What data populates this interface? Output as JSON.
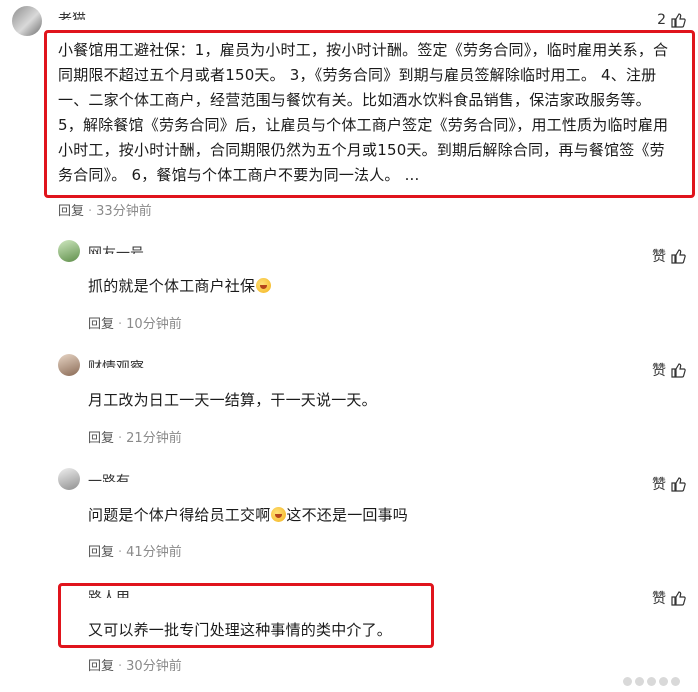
{
  "comments": [
    {
      "username": "老猫",
      "like_count": "2",
      "text": "小餐馆用工避社保：1，雇员为小时工，按小时计酬。签定《劳务合同》，临时雇用关系，合同期限不超过五个月或者150天。 3，《劳务合同》到期与雇员签解除临时用工。 4、注册一、二家个体工商户，经营范围与餐饮有关。比如酒水饮料食品销售，保洁家政服务等。 5，解除餐馆《劳务合同》后，让雇员与个体工商户签定《劳务合同》，用工性质为临时雇用小时工，按小时计酬，合同期限仍然为五个月或150天。到期后解除合同，再与餐馆签《劳务合同》。 6，餐馆与个体工商户不要为同一法人。 ...",
      "reply_label": "回复",
      "time": "33分钟前"
    },
    {
      "username": "网友一号",
      "like_label": "赞",
      "text": "抓的就是个体工商户社保",
      "reply_label": "回复",
      "time": "10分钟前"
    },
    {
      "username": "财情观察",
      "like_label": "赞",
      "text": "月工改为日工一天一结算，干一天说一天。",
      "reply_label": "回复",
      "time": "21分钟前"
    },
    {
      "username": "一路有",
      "like_label": "赞",
      "text": "问题是个体户得给员工交啊",
      "text_after_emoji": "这不还是一回事吗",
      "reply_label": "回复",
      "time": "41分钟前"
    },
    {
      "username": "路人甲",
      "like_label": "赞",
      "text": "又可以养一批专门处理这种事情的类中介了。",
      "reply_label": "回复",
      "time": "30分钟前"
    }
  ],
  "icons": {
    "like": "thumbs-up-icon",
    "emoji": "laughing-face-icon"
  },
  "colors": {
    "highlight_border": "#e0141c",
    "meta_text": "#8a8a8a"
  }
}
